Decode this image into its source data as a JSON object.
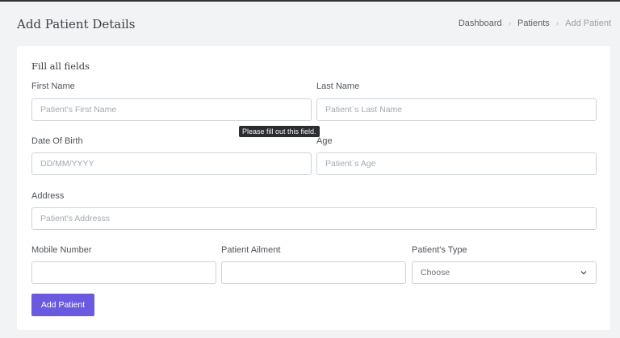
{
  "header": {
    "title": "Add Patient Details",
    "breadcrumb": [
      "Dashboard",
      "Patients",
      "Add Patient"
    ]
  },
  "form": {
    "heading": "Fill all fields",
    "first_name": {
      "label": "First Name",
      "placeholder": "Patient's First Name"
    },
    "last_name": {
      "label": "Last Name",
      "placeholder": "Patient`s Last Name"
    },
    "dob": {
      "label": "Date Of Birth",
      "placeholder": "DD/MM/YYYY"
    },
    "age": {
      "label": "Age",
      "placeholder": "Patient`s Age"
    },
    "address": {
      "label": "Address",
      "placeholder": "Patient's Addresss"
    },
    "mobile": {
      "label": "Mobile Number",
      "placeholder": ""
    },
    "ailment": {
      "label": "Patient Ailment",
      "placeholder": ""
    },
    "type": {
      "label": "Patient's Type",
      "selected": "Choose"
    },
    "tooltip": "Please fill out this field.",
    "submit_label": "Add Patient"
  },
  "colors": {
    "accent": "#6a5ae0",
    "background": "#f2f3f5"
  }
}
